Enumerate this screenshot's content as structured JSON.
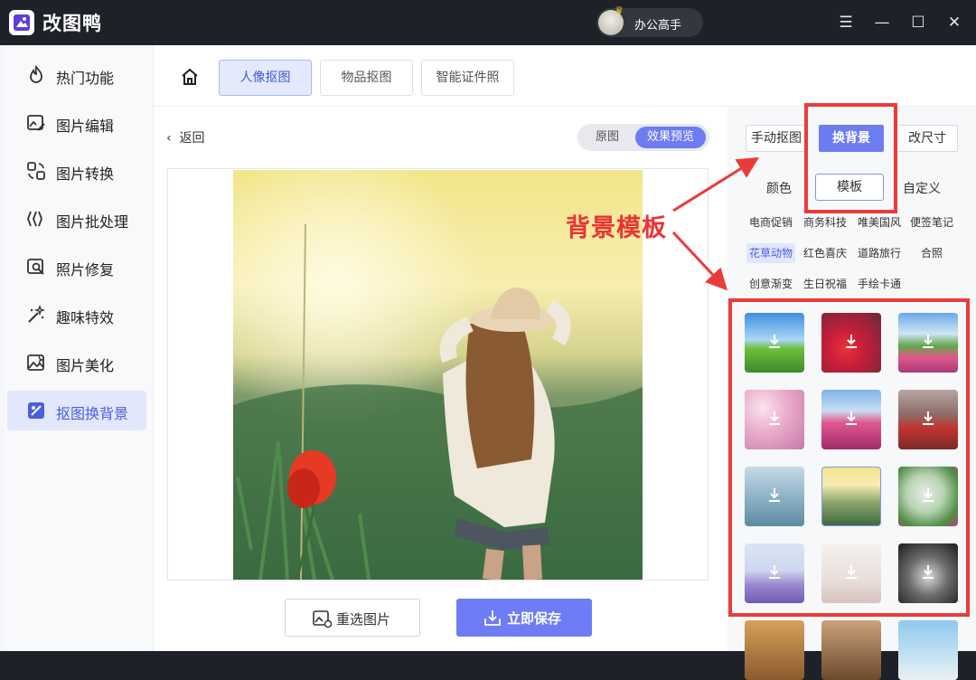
{
  "app": {
    "title": "改图鸭",
    "user_name": "办公高手"
  },
  "window_controls": {
    "menu": "☰",
    "minimize": "—",
    "maximize": "☐",
    "close": "✕"
  },
  "sidebar": {
    "items": [
      {
        "label": "热门功能",
        "icon": "flame-icon"
      },
      {
        "label": "图片编辑",
        "icon": "image-edit-icon"
      },
      {
        "label": "图片转换",
        "icon": "convert-icon"
      },
      {
        "label": "图片批处理",
        "icon": "batch-icon"
      },
      {
        "label": "照片修复",
        "icon": "repair-icon"
      },
      {
        "label": "趣味特效",
        "icon": "magic-wand-icon"
      },
      {
        "label": "图片美化",
        "icon": "beautify-icon"
      },
      {
        "label": "抠图换背景",
        "icon": "cutout-icon",
        "active": true
      }
    ]
  },
  "top_tabs": {
    "tabs": [
      {
        "label": "人像抠图",
        "active": true
      },
      {
        "label": "物品抠图"
      },
      {
        "label": "智能证件照"
      }
    ]
  },
  "editor": {
    "back_label": "返回",
    "view_toggle": {
      "original": "原图",
      "preview": "效果预览",
      "selected": "preview"
    },
    "reselect_label": "重选图片",
    "save_label": "立即保存"
  },
  "right_panel": {
    "modes": [
      {
        "label": "手动抠图"
      },
      {
        "label": "换背景",
        "active": true
      },
      {
        "label": "改尺寸"
      }
    ],
    "sub_tabs": [
      {
        "label": "颜色"
      },
      {
        "label": "模板",
        "active": true
      },
      {
        "label": "自定义"
      }
    ],
    "categories": [
      "电商促销",
      "商务科技",
      "唯美国风",
      "便签笔记",
      "花草动物",
      "红色喜庆",
      "道路旅行",
      "合照",
      "创意渐变",
      "生日祝福",
      "手绘卡通"
    ],
    "active_category": "花草动物",
    "templates": [
      "windmill-field",
      "red-poppies",
      "tulip-field",
      "cherry-blossom",
      "tulip-rows",
      "red-tractor",
      "blue-flowers",
      "sunset-meadow",
      "pink-tulips",
      "lavender-house",
      "penguin",
      "cat",
      "autumn-leaves",
      "dog",
      "beach"
    ]
  },
  "annotation": {
    "label": "背景模板",
    "color": "#ea3b3b"
  },
  "colors": {
    "accent": "#6e7cf2",
    "titlebar": "#1e2228",
    "annotation": "#ea3b3b"
  }
}
